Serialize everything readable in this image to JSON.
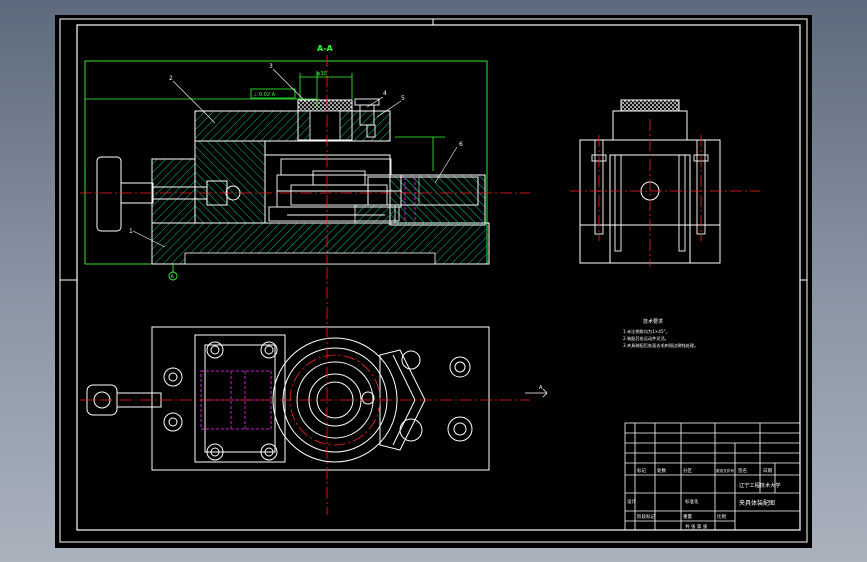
{
  "drawing": {
    "section_label": "A-A",
    "part_numbers": [
      "1",
      "2",
      "3",
      "4",
      "5",
      "6"
    ],
    "dimension_value": "φ30",
    "tolerance_text": "⊥ 0.02 A",
    "datum_label": "A",
    "view_marker": "A"
  },
  "tech_requirements": {
    "title": "技术要求",
    "lines": [
      "1.未注倒角均为1×45°。",
      "2.装配后各运动件灵活。",
      "3.夹具装配后各面去毛刺锐边倒钝处理。"
    ]
  },
  "title_block": {
    "school": "辽宁工程技术大学",
    "drawing_title": "夹具体装配图",
    "col_headers": [
      "标记",
      "处数",
      "分区",
      "更改文件号",
      "签名",
      "日期"
    ],
    "design_row": [
      "设计",
      "",
      "",
      "标准化",
      "",
      ""
    ],
    "scale_label": "比例",
    "weight_label": "重量",
    "stage_label": "阶段标记",
    "sheet_label": "共 张 第 张"
  },
  "colors": {
    "background": "#000000",
    "outline": "#ffffff",
    "frame": "#ffffff",
    "section_hatch": "#00b38f",
    "center_line": "#ff2020",
    "hidden_line": "#d020d0",
    "dimension": "#30ff30",
    "leader": "#ffffff",
    "title_block": "#ffffff"
  }
}
